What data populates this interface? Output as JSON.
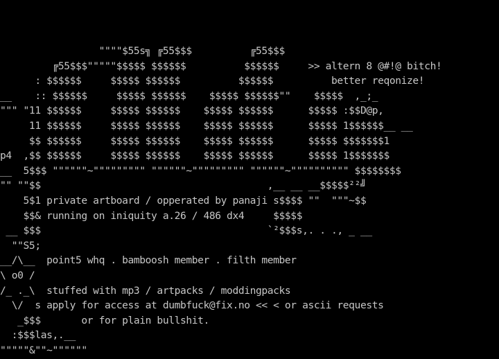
{
  "terminal": {
    "fg_color": "#c7c7c7",
    "bg_color": "#000000",
    "art": "                 \"\"\"\"$55s╗ ╔55$$$          ╔55$$$\n         ╔55$$$\"\"\"\"\"$$$$$ $$$$$$          $$$$$$     >> altern 8 @#!@ bitch!\n      : $$$$$$     $$$$$ $$$$$$          $$$$$$          better reqonize!\n__    :: $$$$$$     $$$$$ $$$$$$    $$$$$ $$$$$$\"\"    $$$$$  ,_;_\n\"\"\" \"11 $$$$$$     $$$$$ $$$$$$    $$$$$ $$$$$$      $$$$$ :$$D@p,\n     11 $$$$$$     $$$$$ $$$$$$    $$$$$ $$$$$$      $$$$$ 1$$$$$$__ __\n     $$ $$$$$$     $$$$$ $$$$$$    $$$$$ $$$$$$      $$$$$ $$$$$$$1\np4  ,$$ $$$$$$     $$$$$ $$$$$$    $$$$$ $$$$$$      $$$$$ 1$$$$$$$\n__  5$$$ \"\"\"\"\"\"~\"\"\"\"\"\"\"\"\" \"\"\"\"\"\"~\"\"\"\"\"\"\"\"\" \"\"\"\"\"\"~\"\"\"\"\"\"\"\"\"\" $$$$$$$$\n\"\" \"\"$$                                       ,__ __ __$$$$$²²╝\n    5$1 private artboard / opperated by panaji s$$$$ \"\"  \"\"\"~$$\n    $$& running on iniquity a.26 / 486 dx4     $$$$$\n __ $$$                                       `²$$$s,. . ., _ __\n  \"\"S5;\n__/\\__  point5 whq . bamboosh member . filth member\n\\ o0 /\n/_ ._\\  stuffed with mp3 / artpacks / moddingpacks\n  \\/  s apply for access at dumbfuck@fix.no << < or ascii requests\n   _$$$       or for plain bullshit.\n  :$$$las,.__\n\"\"\"\"\"&\"\"~\"\"\"\"\"\""
  }
}
